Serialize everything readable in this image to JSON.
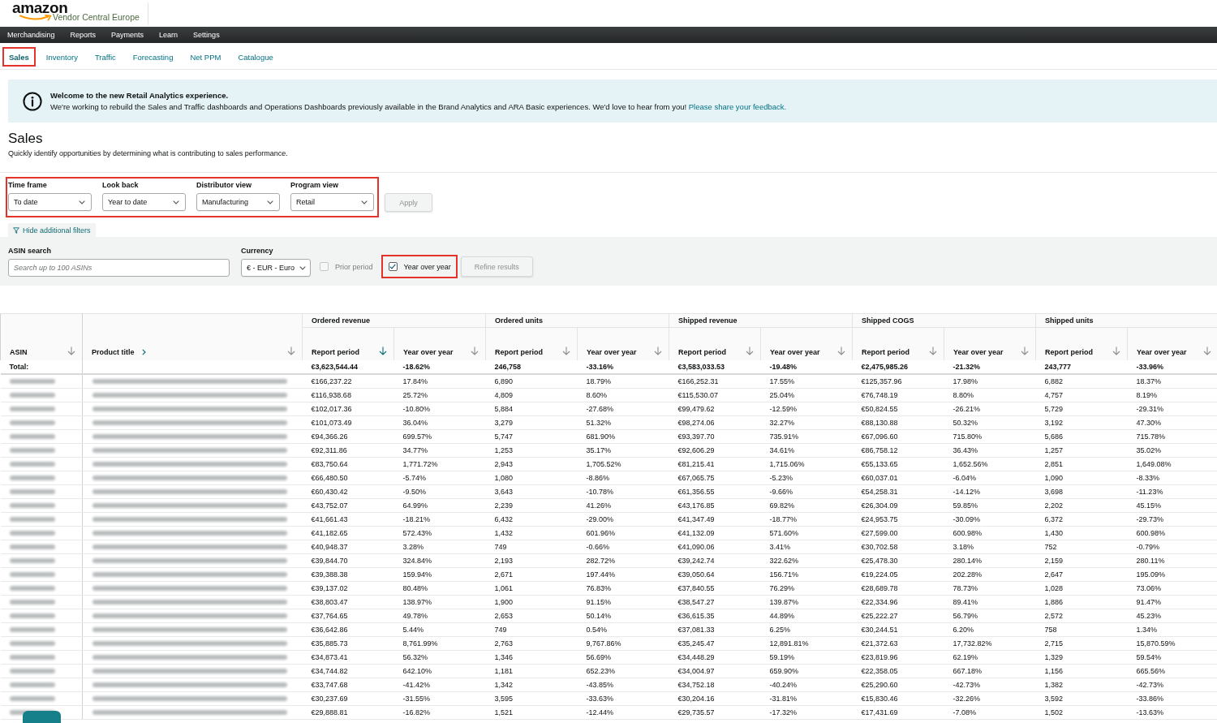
{
  "header": {
    "logo_text": "amazon",
    "logo_subtitle": "Vendor Central Europe"
  },
  "nav": [
    "Merchandising",
    "Reports",
    "Payments",
    "Learn",
    "Settings"
  ],
  "tabs": [
    {
      "label": "Sales",
      "selected": true,
      "highlighted": true
    },
    {
      "label": "Inventory",
      "selected": false,
      "highlighted": false
    },
    {
      "label": "Traffic",
      "selected": false,
      "highlighted": false
    },
    {
      "label": "Forecasting",
      "selected": false,
      "highlighted": false
    },
    {
      "label": "Net PPM",
      "selected": false,
      "highlighted": false
    },
    {
      "label": "Catalogue",
      "selected": false,
      "highlighted": false
    }
  ],
  "banner": {
    "title": "Welcome to the new Retail Analytics experience.",
    "text": "We're working to rebuild the Sales and Traffic dashboards and Operations Dashboards previously available in the Brand Analytics and ARA Basic experiences. We'd love to hear from you!",
    "link": "Please share your feedback."
  },
  "page": {
    "title": "Sales",
    "subtitle": "Quickly identify opportunities by determining what is contributing to sales performance."
  },
  "filters": {
    "highlighted": true,
    "dropdowns": [
      {
        "label": "Time frame",
        "value": "To date"
      },
      {
        "label": "Look back",
        "value": "Year to date"
      },
      {
        "label": "Distributor view",
        "value": "Manufacturing"
      },
      {
        "label": "Program view",
        "value": "Retail"
      }
    ],
    "apply_button": {
      "label": "Apply",
      "disabled": true
    }
  },
  "filter_toggle": "Hide additional filters",
  "additional_filters": {
    "asin_search": {
      "label": "ASIN search",
      "placeholder": "Search up to 100 ASINs"
    },
    "currency": {
      "label": "Currency",
      "value": "€ - EUR - Euro"
    },
    "checkboxes": [
      {
        "label": "Prior period",
        "checked": false,
        "disabled": true,
        "highlighted": false
      },
      {
        "label": "Year over year",
        "checked": true,
        "disabled": false,
        "highlighted": true
      }
    ],
    "refine_button": {
      "label": "Refine results",
      "disabled": true
    }
  },
  "table": {
    "fixed_columns": [
      {
        "label": "ASIN",
        "sorted": false,
        "expandable": false
      },
      {
        "label": "Product title",
        "sorted": false,
        "expandable": true
      }
    ],
    "groups": [
      {
        "label": "Ordered revenue",
        "columns": [
          {
            "label": "Report period",
            "sorted": true
          },
          {
            "label": "Year over year",
            "sorted": false
          }
        ]
      },
      {
        "label": "Ordered units",
        "columns": [
          {
            "label": "Report period",
            "sorted": false
          },
          {
            "label": "Year over year",
            "sorted": false
          }
        ]
      },
      {
        "label": "Shipped revenue",
        "columns": [
          {
            "label": "Report period",
            "sorted": false
          },
          {
            "label": "Year over year",
            "sorted": false
          }
        ]
      },
      {
        "label": "Shipped COGS",
        "columns": [
          {
            "label": "Report period",
            "sorted": false
          },
          {
            "label": "Year over year",
            "sorted": false
          }
        ]
      },
      {
        "label": "Shipped units",
        "columns": [
          {
            "label": "Report period",
            "sorted": false
          },
          {
            "label": "Year over year",
            "sorted": false
          }
        ]
      }
    ],
    "total": {
      "label": "Total:",
      "values": [
        "€3,623,544.44",
        "-18.62%",
        "246,758",
        "-33.16%",
        "€3,583,033.53",
        "-19.48%",
        "€2,475,985.26",
        "-21.32%",
        "243,777",
        "-33.96%"
      ]
    },
    "rows": [
      {
        "values": [
          "€166,237.22",
          "17.84%",
          "6,890",
          "18.79%",
          "€166,252.31",
          "17.55%",
          "€125,357.96",
          "17.98%",
          "6,882",
          "18.37%"
        ]
      },
      {
        "values": [
          "€116,938.68",
          "25.72%",
          "4,809",
          "8.60%",
          "€115,530.07",
          "25.04%",
          "€76,748.19",
          "8.80%",
          "4,757",
          "8.19%"
        ]
      },
      {
        "values": [
          "€102,017.36",
          "-10.80%",
          "5,884",
          "-27.68%",
          "€99,479.62",
          "-12.59%",
          "€50,824.55",
          "-26.21%",
          "5,729",
          "-29.31%"
        ]
      },
      {
        "values": [
          "€101,073.49",
          "36.04%",
          "3,279",
          "51.32%",
          "€98,274.06",
          "32.27%",
          "€88,130.88",
          "50.32%",
          "3,192",
          "47.30%"
        ]
      },
      {
        "values": [
          "€94,366.26",
          "699.57%",
          "5,747",
          "681.90%",
          "€93,397.70",
          "735.91%",
          "€67,096.60",
          "715.80%",
          "5,686",
          "715.78%"
        ]
      },
      {
        "values": [
          "€92,311.86",
          "34.77%",
          "1,253",
          "35.17%",
          "€92,606.29",
          "34.61%",
          "€86,758.12",
          "36.43%",
          "1,257",
          "35.02%"
        ]
      },
      {
        "values": [
          "€83,750.64",
          "1,771.72%",
          "2,943",
          "1,705.52%",
          "€81,215.41",
          "1,715.06%",
          "€55,133.65",
          "1,652.56%",
          "2,851",
          "1,649.08%"
        ]
      },
      {
        "values": [
          "€66,480.50",
          "-5.74%",
          "1,080",
          "-8.86%",
          "€67,065.75",
          "-5.23%",
          "€60,037.01",
          "-6.04%",
          "1,090",
          "-8.33%"
        ]
      },
      {
        "values": [
          "€60,430.42",
          "-9.50%",
          "3,643",
          "-10.78%",
          "€61,356.55",
          "-9.66%",
          "€54,258.31",
          "-14.12%",
          "3,698",
          "-11.23%"
        ]
      },
      {
        "values": [
          "€43,752.07",
          "64.99%",
          "2,239",
          "41.26%",
          "€43,176.85",
          "69.82%",
          "€26,304.09",
          "59.85%",
          "2,202",
          "45.15%"
        ]
      },
      {
        "values": [
          "€41,661.43",
          "-18.21%",
          "6,432",
          "-29.00%",
          "€41,347.49",
          "-18.77%",
          "€24,953.75",
          "-30.09%",
          "6,372",
          "-29.73%"
        ]
      },
      {
        "values": [
          "€41,182.65",
          "572.43%",
          "1,432",
          "601.96%",
          "€41,132.09",
          "571.60%",
          "€27,599.00",
          "600.98%",
          "1,430",
          "600.98%"
        ]
      },
      {
        "values": [
          "€40,948.37",
          "3.28%",
          "749",
          "-0.66%",
          "€41,090.06",
          "3.41%",
          "€30,702.58",
          "3.18%",
          "752",
          "-0.79%"
        ]
      },
      {
        "values": [
          "€39,844.70",
          "324.84%",
          "2,193",
          "282.72%",
          "€39,242.74",
          "322.62%",
          "€25,478.30",
          "280.14%",
          "2,159",
          "280.11%"
        ]
      },
      {
        "values": [
          "€39,388.38",
          "159.94%",
          "2,671",
          "197.44%",
          "€39,050.64",
          "156.71%",
          "€19,224.05",
          "202.28%",
          "2,647",
          "195.09%"
        ]
      },
      {
        "values": [
          "€39,137.02",
          "80.48%",
          "1,061",
          "76.83%",
          "€37,840.55",
          "76.29%",
          "€28,689.78",
          "78.73%",
          "1,028",
          "73.06%"
        ]
      },
      {
        "values": [
          "€38,803.47",
          "138.97%",
          "1,900",
          "91.15%",
          "€38,547.27",
          "139.87%",
          "€22,334.96",
          "89.41%",
          "1,886",
          "91.47%"
        ]
      },
      {
        "values": [
          "€37,764.65",
          "49.78%",
          "2,653",
          "50.14%",
          "€36,615.35",
          "44.89%",
          "€25,222.27",
          "56.79%",
          "2,572",
          "45.23%"
        ]
      },
      {
        "values": [
          "€36,642.86",
          "5.44%",
          "749",
          "0.54%",
          "€37,081.33",
          "6.25%",
          "€30,244.51",
          "6.20%",
          "758",
          "1.34%"
        ]
      },
      {
        "values": [
          "€35,885.73",
          "8,761.99%",
          "2,763",
          "9,767.86%",
          "€35,245.47",
          "12,891.81%",
          "€21,372.63",
          "17,732.82%",
          "2,715",
          "15,870.59%"
        ]
      },
      {
        "values": [
          "€34,873.41",
          "56.32%",
          "1,346",
          "56.69%",
          "€34,448.29",
          "59.19%",
          "€23,819.96",
          "62.19%",
          "1,329",
          "59.54%"
        ]
      },
      {
        "values": [
          "€34,744.82",
          "642.10%",
          "1,181",
          "652.23%",
          "€34,004.97",
          "659.90%",
          "€22,358.05",
          "667.18%",
          "1,156",
          "665.56%"
        ]
      },
      {
        "values": [
          "€33,747.68",
          "-41.42%",
          "1,342",
          "-43.85%",
          "€34,752.18",
          "-40.24%",
          "€25,290.60",
          "-42.73%",
          "1,382",
          "-42.73%"
        ]
      },
      {
        "values": [
          "€30,237.69",
          "-31.55%",
          "3,595",
          "-33.63%",
          "€30,204.16",
          "-31.81%",
          "€15,830.46",
          "-32.26%",
          "3,592",
          "-33.86%"
        ]
      },
      {
        "values": [
          "€29,888.81",
          "-16.82%",
          "1,521",
          "-12.44%",
          "€29,735.57",
          "-17.32%",
          "€17,431.69",
          "-7.08%",
          "1,502",
          "-13.63%"
        ]
      }
    ]
  }
}
